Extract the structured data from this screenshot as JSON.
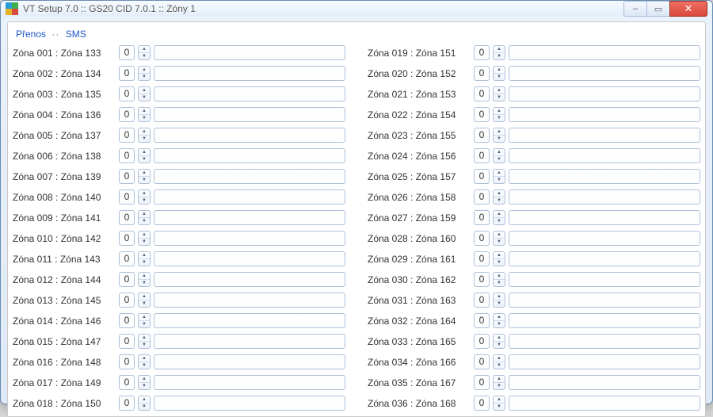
{
  "window": {
    "title": "VT Setup 7.0 :: GS20 CID 7.0.1 :: Zóny 1"
  },
  "breadcrumbs": {
    "item1": "Přenos",
    "separator": "··",
    "item2": "SMS"
  },
  "zones_left": [
    {
      "label": "Zóna 001 : Zóna 133",
      "num": "0",
      "text": ""
    },
    {
      "label": "Zóna 002 : Zóna 134",
      "num": "0",
      "text": ""
    },
    {
      "label": "Zóna 003 : Zóna 135",
      "num": "0",
      "text": ""
    },
    {
      "label": "Zóna 004 : Zóna 136",
      "num": "0",
      "text": ""
    },
    {
      "label": "Zóna 005 : Zóna 137",
      "num": "0",
      "text": ""
    },
    {
      "label": "Zóna 006 : Zóna 138",
      "num": "0",
      "text": ""
    },
    {
      "label": "Zóna 007 : Zóna 139",
      "num": "0",
      "text": ""
    },
    {
      "label": "Zóna 008 : Zóna 140",
      "num": "0",
      "text": ""
    },
    {
      "label": "Zóna 009 : Zóna 141",
      "num": "0",
      "text": ""
    },
    {
      "label": "Zóna 010 : Zóna 142",
      "num": "0",
      "text": ""
    },
    {
      "label": "Zóna 011 : Zóna 143",
      "num": "0",
      "text": ""
    },
    {
      "label": "Zóna 012 : Zóna 144",
      "num": "0",
      "text": ""
    },
    {
      "label": "Zóna 013 : Zóna 145",
      "num": "0",
      "text": ""
    },
    {
      "label": "Zóna 014 : Zóna 146",
      "num": "0",
      "text": ""
    },
    {
      "label": "Zóna 015 : Zóna 147",
      "num": "0",
      "text": ""
    },
    {
      "label": "Zóna 016 : Zóna 148",
      "num": "0",
      "text": ""
    },
    {
      "label": "Zóna 017 : Zóna 149",
      "num": "0",
      "text": ""
    },
    {
      "label": "Zóna 018 : Zóna 150",
      "num": "0",
      "text": ""
    }
  ],
  "zones_right": [
    {
      "label": "Zóna 019 : Zóna 151",
      "num": "0",
      "text": ""
    },
    {
      "label": "Zóna 020 : Zóna 152",
      "num": "0",
      "text": ""
    },
    {
      "label": "Zóna 021 : Zóna 153",
      "num": "0",
      "text": ""
    },
    {
      "label": "Zóna 022 : Zóna 154",
      "num": "0",
      "text": ""
    },
    {
      "label": "Zóna 023 : Zóna 155",
      "num": "0",
      "text": ""
    },
    {
      "label": "Zóna 024 : Zóna 156",
      "num": "0",
      "text": ""
    },
    {
      "label": "Zóna 025 : Zóna 157",
      "num": "0",
      "text": ""
    },
    {
      "label": "Zóna 026 : Zóna 158",
      "num": "0",
      "text": ""
    },
    {
      "label": "Zóna 027 : Zóna 159",
      "num": "0",
      "text": ""
    },
    {
      "label": "Zóna 028 : Zóna 160",
      "num": "0",
      "text": ""
    },
    {
      "label": "Zóna 029 : Zóna 161",
      "num": "0",
      "text": ""
    },
    {
      "label": "Zóna 030 : Zóna 162",
      "num": "0",
      "text": ""
    },
    {
      "label": "Zóna 031 : Zóna 163",
      "num": "0",
      "text": ""
    },
    {
      "label": "Zóna 032 : Zóna 164",
      "num": "0",
      "text": ""
    },
    {
      "label": "Zóna 033 : Zóna 165",
      "num": "0",
      "text": ""
    },
    {
      "label": "Zóna 034 : Zóna 166",
      "num": "0",
      "text": ""
    },
    {
      "label": "Zóna 035 : Zóna 167",
      "num": "0",
      "text": ""
    },
    {
      "label": "Zóna 036 : Zóna 168",
      "num": "0",
      "text": ""
    }
  ]
}
